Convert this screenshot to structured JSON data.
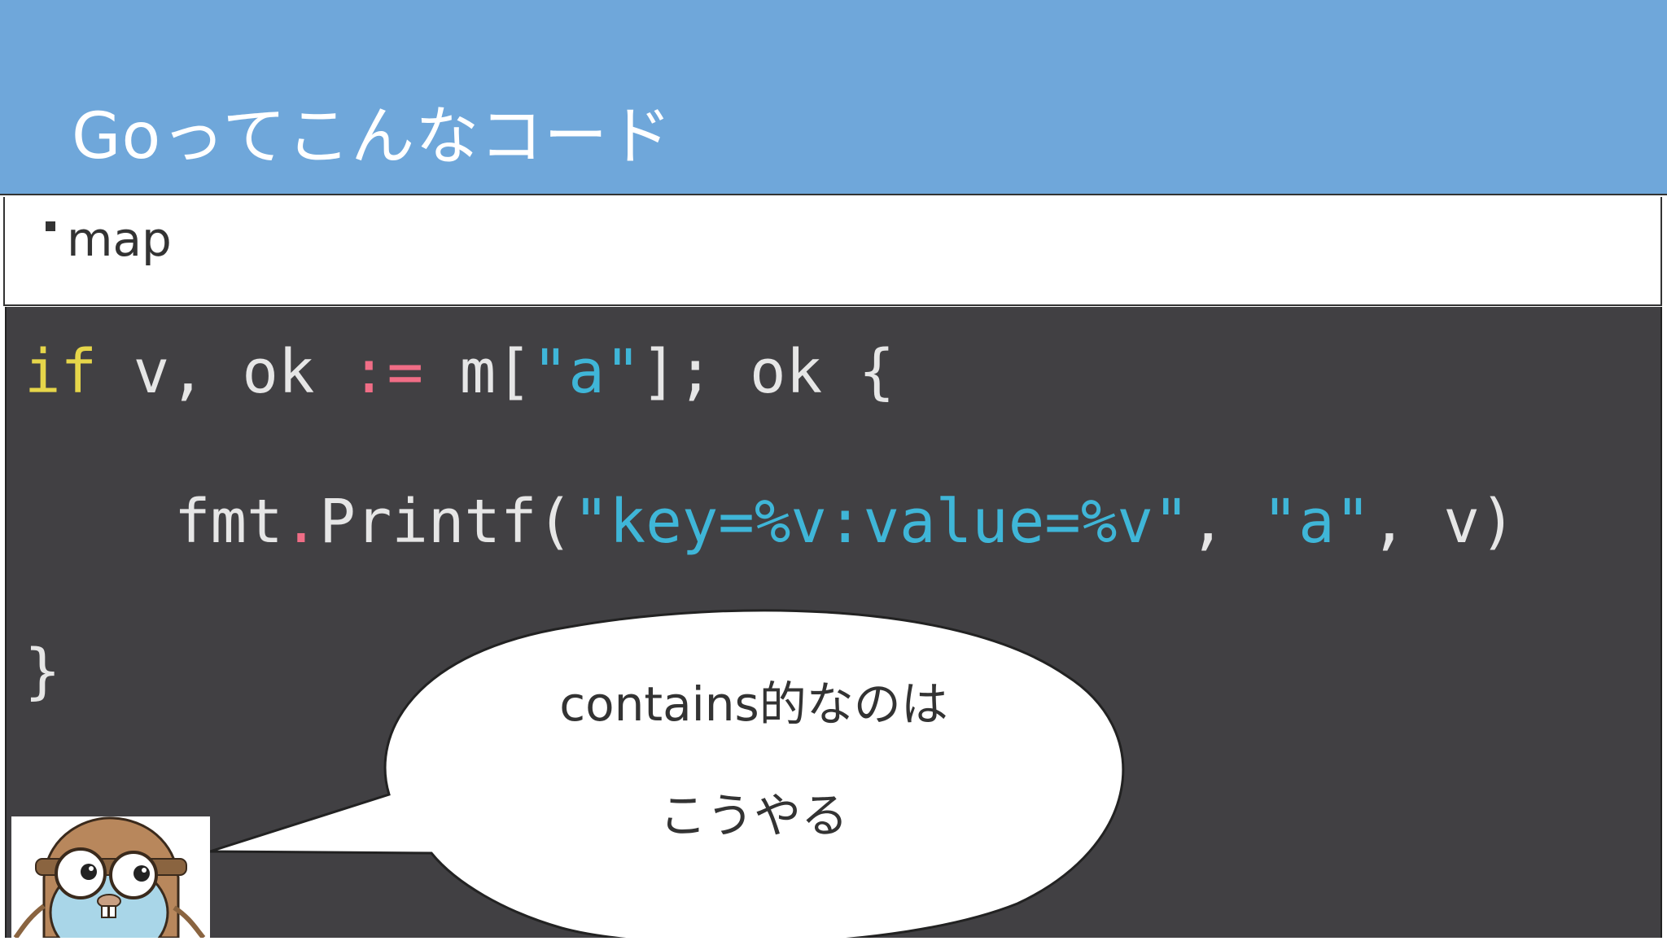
{
  "slide": {
    "title": "Goってこんなコード",
    "bullet": "map"
  },
  "code": {
    "line1": {
      "kw_if": "if",
      "part_a": " v, ok ",
      "op_assign": ":=",
      "part_b": " m[",
      "str_a": "\"a\"",
      "part_c": "]; ok {"
    },
    "line2": {
      "part_a": "fmt",
      "op_dot": ".",
      "part_b": "Printf(",
      "str_fmt": "\"key=%v:value=%v\"",
      "part_c": ", ",
      "str_a": "\"a\"",
      "part_d": ", v)"
    },
    "line3": {
      "part_a": "}"
    }
  },
  "bubble": {
    "line1": "contains的なのは",
    "line2": "こうやる"
  },
  "colors": {
    "header_bg": "#6fa7da",
    "code_bg": "#414043",
    "keyword": "#e6d64a",
    "operator": "#f06d86",
    "string": "#3fb6d8"
  },
  "icons": {
    "mascot": "gopher-mascot-icon"
  }
}
